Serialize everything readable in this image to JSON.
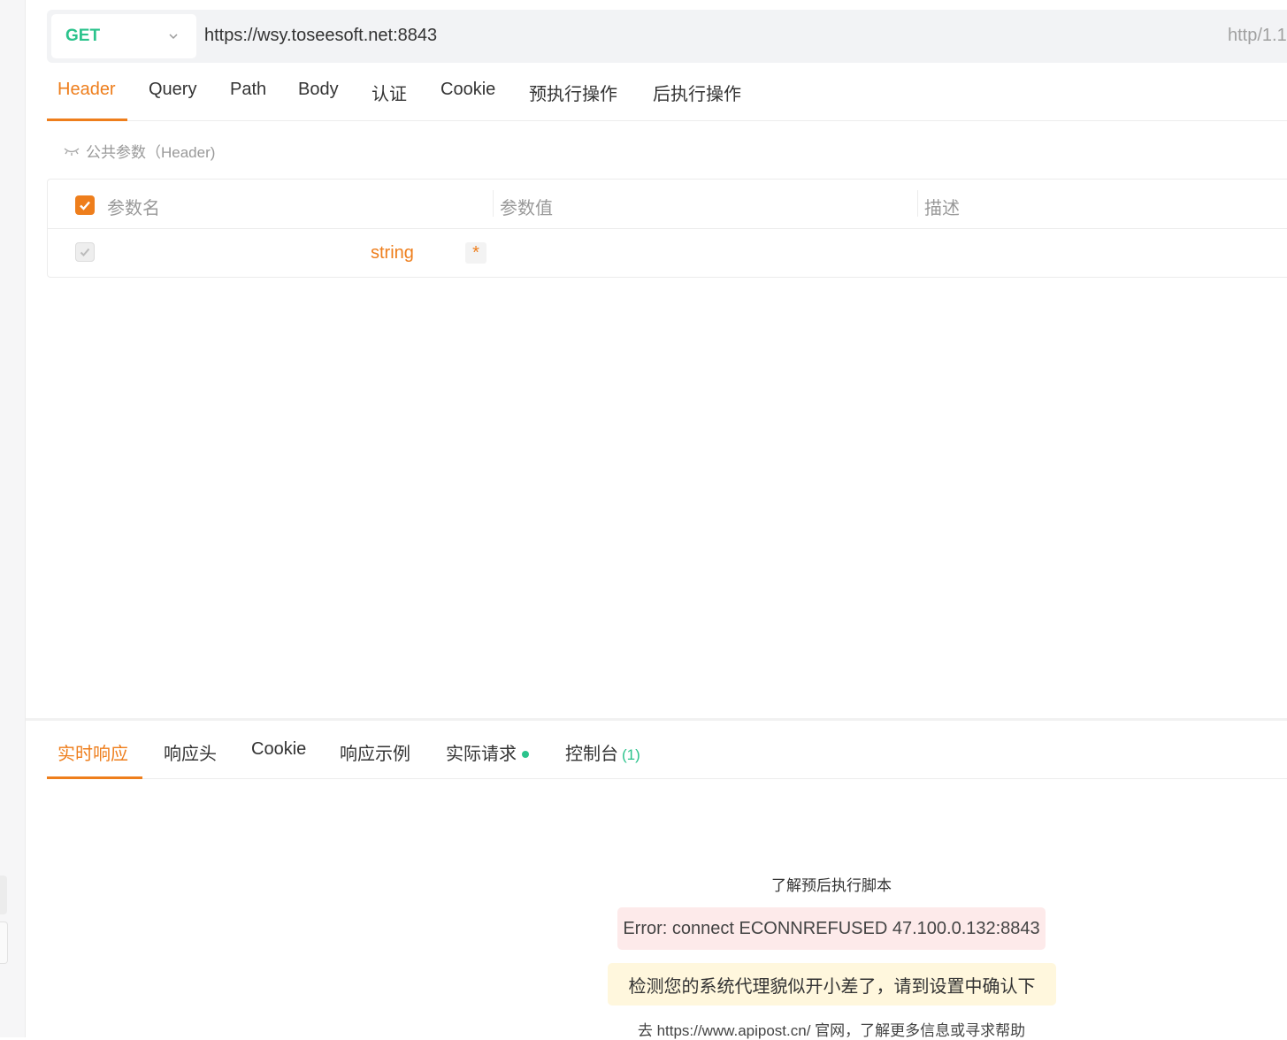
{
  "request": {
    "method": "GET",
    "url": "https://wsy.toseesoft.net:8843",
    "protocol": "http/1.1"
  },
  "request_tabs": {
    "header": "Header",
    "query": "Query",
    "path": "Path",
    "body": "Body",
    "auth": "认证",
    "cookie": "Cookie",
    "pre_script": "预执行操作",
    "post_script": "后执行操作"
  },
  "public_params": "公共参数（Header)",
  "param_table": {
    "col_name": "参数名",
    "col_value": "参数值",
    "col_desc": "描述",
    "row": {
      "type": "string",
      "required_mark": "*"
    }
  },
  "response_tabs": {
    "realtime": "实时响应",
    "headers": "响应头",
    "cookie": "Cookie",
    "examples": "响应示例",
    "actual_request": "实际请求",
    "console": "控制台",
    "console_count": "(1)"
  },
  "response": {
    "learn_link": "了解预后执行脚本",
    "error": "Error: connect ECONNREFUSED 47.100.0.132:8843",
    "proxy_warning": "检测您的系统代理貌似开小差了，请到设置中确认下",
    "help_prefix": "去",
    "help_link": "https://www.apipost.cn/",
    "help_suffix": "官网，了解更多信息或寻求帮助"
  },
  "colors": {
    "accent": "#ee7e1c",
    "method_green": "#2bc38c",
    "error_bg": "#fdeaea",
    "warning_bg": "#fff7dd"
  }
}
